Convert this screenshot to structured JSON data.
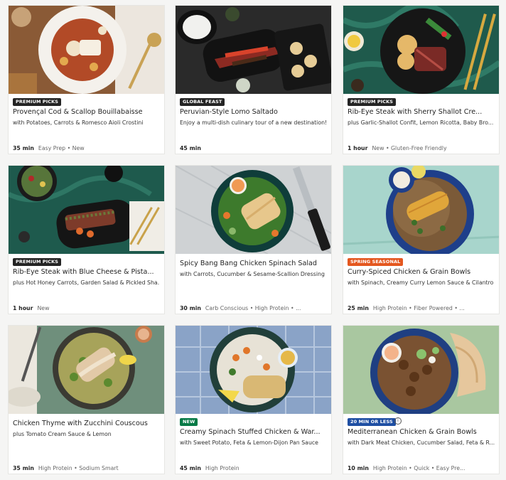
{
  "colors": {
    "premium": "#242424",
    "global": "#242424",
    "spring": "#e4571f",
    "new": "#067a46",
    "quick": "#1f4fa3"
  },
  "recipes": [
    {
      "badge": "PREMIUM PICKS",
      "title": "Provençal Cod & Scallop Bouillabaisse",
      "subtitle": "with Potatoes, Carrots & Romesco Aioli Crostini",
      "time": "35 min",
      "tags": "Easy Prep • New"
    },
    {
      "badge": "GLOBAL FEAST",
      "title": "Peruvian-Style Lomo Saltado",
      "subtitle": "Enjoy a multi-dish culinary tour of a new destination!",
      "time": "45 min",
      "tags": ""
    },
    {
      "badge": "PREMIUM PICKS",
      "title": "Rib-Eye Steak with Sherry Shallot Cre...",
      "subtitle": "plus Garlic-Shallot Confit, Lemon Ricotta, Baby Bro...",
      "time": "1 hour",
      "tags": "New • Gluten-Free Friendly"
    },
    {
      "badge": "PREMIUM PICKS",
      "title": "Rib-Eye Steak with Blue Cheese & Pista...",
      "subtitle": "plus Hot Honey Carrots, Garden Salad & Pickled Sha...",
      "time": "1 hour",
      "tags": "New"
    },
    {
      "badge": "",
      "title": "Spicy Bang Bang Chicken Spinach Salad",
      "subtitle": "with Carrots, Cucumber & Sesame-Scallion Dressing",
      "time": "30 min",
      "tags": "Carb Conscious • High Protein • ..."
    },
    {
      "badge": "SPRING SEASONAL",
      "title": "Curry-Spiced Chicken & Grain Bowls",
      "subtitle": "with Spinach, Creamy Curry Lemon Sauce & Cilantro",
      "time": "25 min",
      "tags": "High Protein • Fiber Powered • ..."
    },
    {
      "badge": "",
      "title": "Chicken Thyme with Zucchini Couscous",
      "subtitle": "plus Tomato Cream Sauce & Lemon",
      "time": "35 min",
      "tags": "High Protein • Sodium Smart"
    },
    {
      "badge": "NEW",
      "title": "Creamy Spinach Stuffed Chicken & War...",
      "subtitle": "with Sweet Potato, Feta & Lemon-Dijon Pan Sauce",
      "time": "45 min",
      "tags": "High Protein"
    },
    {
      "badge": "20 MIN OR LESS",
      "title": "Mediterranean Chicken & Grain Bowls",
      "subtitle": "with Dark Meat Chicken, Cucumber Salad, Feta & R...",
      "time": "10 min",
      "tags": "High Protein • Quick • Easy Pre..."
    }
  ]
}
